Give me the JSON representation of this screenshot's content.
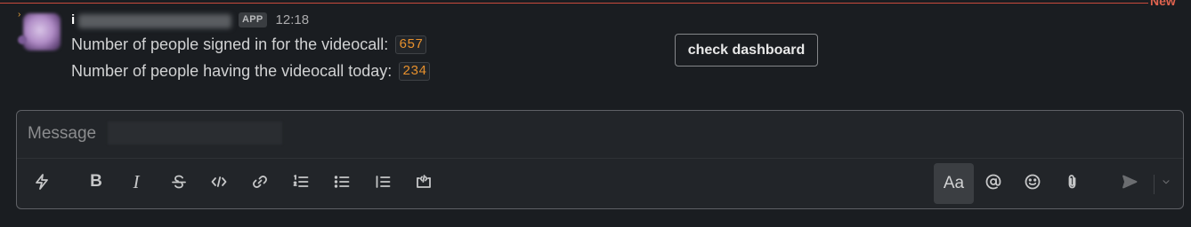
{
  "divider": {
    "label": "New"
  },
  "message": {
    "sender": "i",
    "badge": "APP",
    "time": "12:18",
    "line1": {
      "text": "Number of people signed in for the videocall:",
      "value": "657"
    },
    "line2": {
      "text": "Number of people having the videocall today:",
      "value": "234"
    },
    "button_label": "check dashboard"
  },
  "composer": {
    "placeholder": "Message",
    "toolbar": {
      "bold": "B",
      "italic": "I",
      "text_style": "Aa"
    },
    "icons": [
      "lightning-icon",
      "bold-icon",
      "italic-icon",
      "strikethrough-icon",
      "code-icon",
      "link-icon",
      "ordered-list-icon",
      "bulleted-list-icon",
      "blockquote-icon",
      "code-block-icon",
      "text-format-icon",
      "mention-icon",
      "emoji-icon",
      "attachment-icon",
      "send-icon",
      "chevron-down-icon"
    ]
  },
  "colors": {
    "background": "#1a1d21",
    "new_divider": "#e0634f",
    "code_value": "#e8912d"
  }
}
